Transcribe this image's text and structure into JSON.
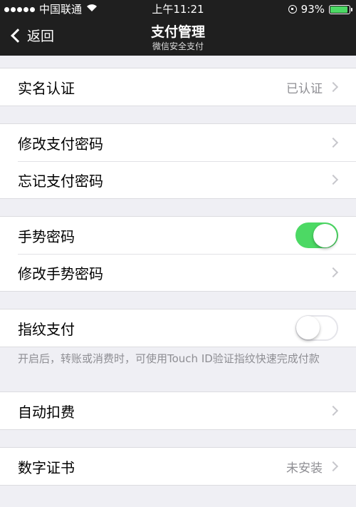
{
  "status_bar": {
    "carrier": "中国联通",
    "time": "上午11:21",
    "battery_percent": "93%",
    "battery_level": 0.93,
    "wifi_icon": "wifi-icon",
    "lock_icon": "orientation-lock-icon"
  },
  "nav": {
    "back_label": "返回",
    "title": "支付管理",
    "subtitle": "微信安全支付"
  },
  "sections": {
    "verify": {
      "label": "实名认证",
      "detail": "已认证"
    },
    "change_pwd": {
      "label": "修改支付密码"
    },
    "forgot_pwd": {
      "label": "忘记支付密码"
    },
    "gesture": {
      "label": "手势密码",
      "enabled": true
    },
    "change_gesture": {
      "label": "修改手势密码"
    },
    "fingerprint": {
      "label": "指纹支付",
      "enabled": false,
      "note": "开启后，转账或消费时，可使用Touch ID验证指纹快速完成付款"
    },
    "auto_deduct": {
      "label": "自动扣费"
    },
    "certificate": {
      "label": "数字证书",
      "detail": "未安装"
    }
  },
  "colors": {
    "toggle_on": "#4cd964",
    "header_bg": "#1f1f1f",
    "page_bg": "#efeff4"
  }
}
